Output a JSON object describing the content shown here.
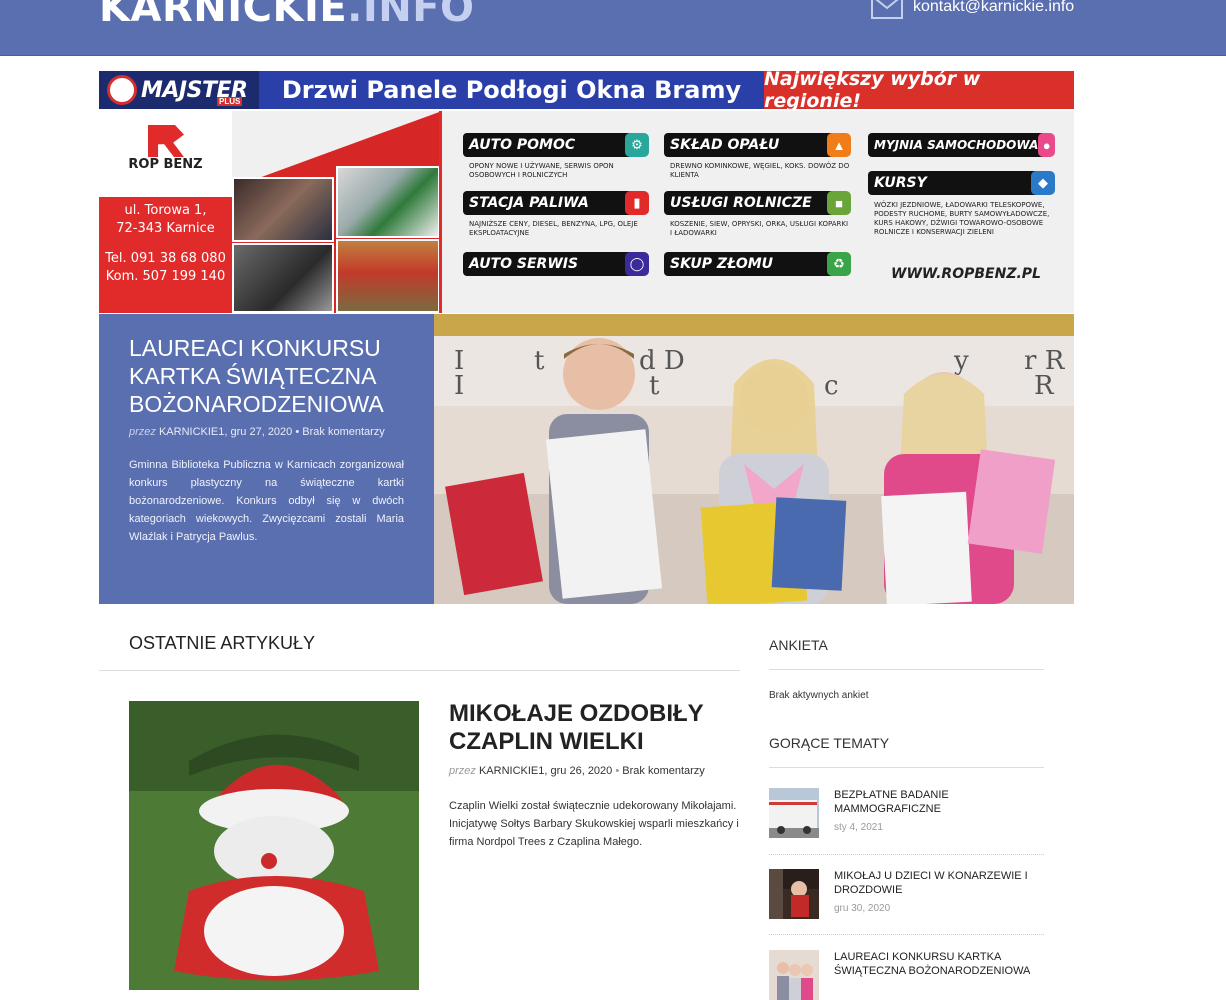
{
  "header": {
    "logo_part1": "KARNICKIE",
    "logo_part2": ".INFO",
    "contact_email": "kontakt@karnickie.info",
    "bg_color": "#5a6fb0"
  },
  "banner_majster": {
    "brand": "MAJSTER",
    "brand_sub": "PLUS",
    "products": "Drzwi Panele Podłogi Okna Bramy",
    "slogan": "Największy wybór w regionie!"
  },
  "banner_ropbenz": {
    "logo_text": "ROP BENZ",
    "address_line1": "ul. Torowa 1,",
    "address_line2": "72-343 Karnice",
    "phone_line1": "Tel. 091 38 68 080",
    "phone_line2": "Kom. 507 199 140",
    "services": [
      {
        "label": "AUTO POMOC",
        "icon": "car-icon",
        "color": "#2aa79b",
        "desc": "Opony nowe i używane, serwis opon osobowych i rolniczych"
      },
      {
        "label": "SKŁAD OPAŁU",
        "icon": "fire-icon",
        "color": "#f07d1a",
        "desc": "Drewno kominkowe, węgiel, koks. Dowóz do klienta"
      },
      {
        "label": "MYJNIA SAMOCHODOWA",
        "icon": "car-wash-icon",
        "color": "#e84a8a",
        "desc": ""
      },
      {
        "label": "STACJA PALIWA",
        "icon": "fuel-icon",
        "color": "#e12b2b",
        "desc": "Najniższe ceny, diesel, benzyna, LPG, oleje eksploatacyjne"
      },
      {
        "label": "USŁUGI ROLNICZE",
        "icon": "tractor-icon",
        "color": "#6aa53a",
        "desc": "Koszenie, siew, opryski, orka, usługi koparki i ładowarki"
      },
      {
        "label": "KURSY",
        "icon": "graduation-icon",
        "color": "#2a7ac8",
        "desc": "Wózki jezdniowe, ładowarki teleskopowe, podesty ruchome, burty samowyładowcze, kurs hakowy, dźwigi towarowo-osobowe rolnicze i konserwacji zieleni"
      },
      {
        "label": "AUTO SERWIS",
        "icon": "tire-icon",
        "color": "#3a2a9a",
        "desc": ""
      },
      {
        "label": "SKUP ZŁOMU",
        "icon": "recycle-icon",
        "color": "#3aa548",
        "desc": ""
      }
    ],
    "website": "WWW.ROPBENZ.PL"
  },
  "featured": {
    "title": "LAUREACI KONKURSU KARTKA ŚWIĄTECZNA BOŻONARODZENIOWA",
    "by_label": "przez",
    "author": "KARNICKIE1",
    "date": "gru 27, 2020",
    "comments": "Brak komentarzy",
    "excerpt": "Gminna Biblioteka Publiczna w Karnicach zorganizował konkurs plastyczny na świąteczne kartki bożonarodzeniowe. Konkurs odbył się w dwóch kategoriach wiekowych. Zwycięzcami zostali Maria Wlaźlak i Patrycja Pawlus."
  },
  "latest": {
    "section_title": "OSTATNIE ARTYKUŁY",
    "posts": [
      {
        "title": "MIKOŁAJE OZDOBIŁY CZAPLIN WIELKI",
        "by_label": "przez",
        "author": "KARNICKIE1",
        "date": "gru 26, 2020",
        "comments": "Brak komentarzy",
        "excerpt": "Czaplin Wielki został świątecznie udekorowany Mikołajami. Inicjatywę Sołtys Barbary Skukowskiej wsparli mieszkańcy i firma Nordpol Trees z Czaplina Małego."
      }
    ]
  },
  "sidebar": {
    "poll_title": "ANKIETA",
    "poll_text": "Brak aktywnych ankiet",
    "hot_title": "GORĄCE TEMATY",
    "hot_items": [
      {
        "title": "BEZPŁATNE BADANIE MAMMOGRAFICZNE",
        "date": "sty 4, 2021"
      },
      {
        "title": "MIKOŁAJ U DZIECI W KONARZEWIE I DROZDOWIE",
        "date": "gru 30, 2020"
      },
      {
        "title": "LAUREACI KONKURSU KARTKA ŚWIĄTECZNA BOŻONARODZENIOWA",
        "date": ""
      }
    ]
  }
}
